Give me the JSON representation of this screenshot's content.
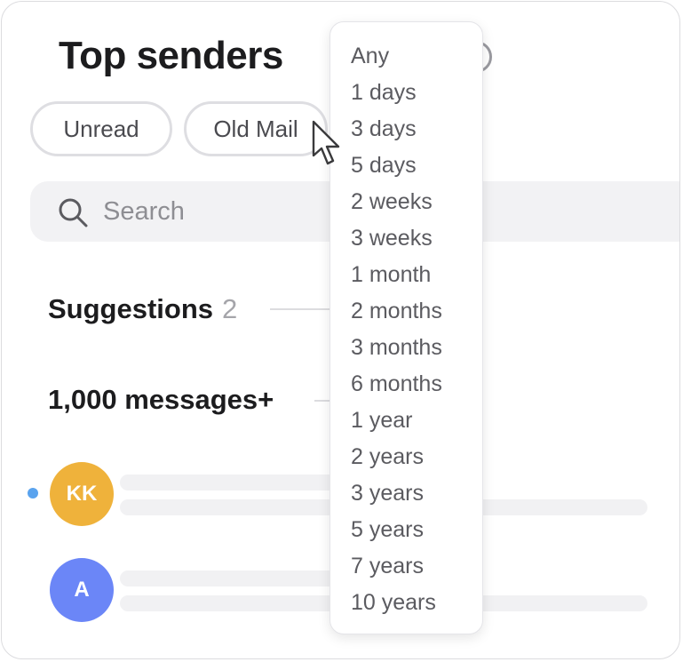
{
  "header": {
    "title": "Top senders"
  },
  "filters": [
    {
      "label": "Unread"
    },
    {
      "label": "Old Mail"
    }
  ],
  "search": {
    "placeholder": "Search"
  },
  "suggestions": {
    "label": "Suggestions",
    "count": "2"
  },
  "group": {
    "label": "1,000 messages+"
  },
  "senders": [
    {
      "initials": "KK",
      "color": "#efb23b",
      "unread": true
    },
    {
      "initials": "A",
      "color": "#6b86f7",
      "unread": false
    }
  ],
  "dropdown": {
    "options": [
      "Any",
      "1 days",
      "3 days",
      "5 days",
      "2 weeks",
      "3 weeks",
      "1 month",
      "2 months",
      "3 months",
      "6 months",
      "1 year",
      "2 years",
      "3 years",
      "5 years",
      "7 years",
      "10 years"
    ]
  },
  "colors": {
    "unread_dot": "#5aa3ee",
    "search_bg": "#f2f2f4",
    "text_primary": "#1c1c1e",
    "text_secondary": "#8e8e93"
  }
}
